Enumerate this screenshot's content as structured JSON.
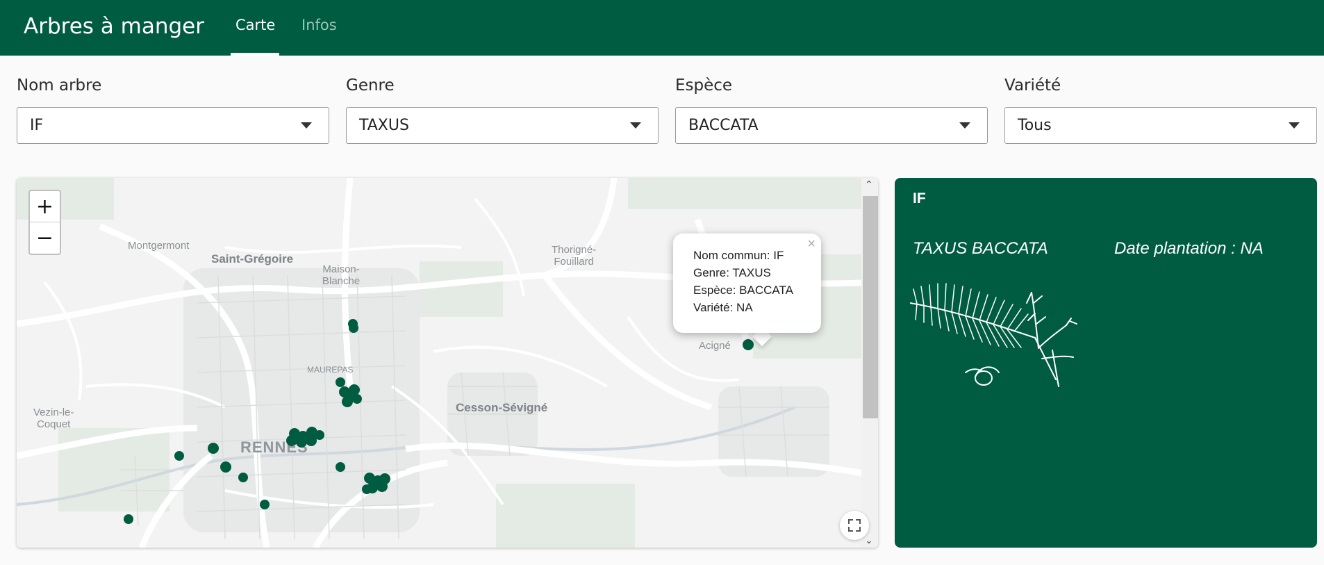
{
  "header": {
    "app_title": "Arbres à manger",
    "tabs": [
      {
        "label": "Carte",
        "active": true
      },
      {
        "label": "Infos",
        "active": false
      }
    ]
  },
  "filters": [
    {
      "label": "Nom arbre",
      "value": "IF"
    },
    {
      "label": "Genre",
      "value": "TAXUS"
    },
    {
      "label": "Espèce",
      "value": "BACCATA"
    },
    {
      "label": "Variété",
      "value": "Tous"
    }
  ],
  "map": {
    "zoom_in": "+",
    "zoom_out": "−",
    "places": {
      "montgermont": "Montgermont",
      "saint_gregoire": "Saint-Grégoire",
      "maison_blanche": "Maison-\nBlanche",
      "thorigne": "Thorigné-\nFouillard",
      "acigne": "Acigné",
      "maurepas": "MAUREPAS",
      "vezin": "Vezin-le-\nCoquet",
      "cesson": "Cesson-Sévigné",
      "rennes": "RENNES"
    },
    "popup": {
      "close": "×",
      "lines": [
        "Nom commun: IF",
        "Genre: TAXUS",
        "Espèce: BACCATA",
        "Variété: NA"
      ]
    },
    "marker_color": "#005c40"
  },
  "card": {
    "title": "IF",
    "species": "TAXUS BACCATA",
    "date": "Date plantation : NA",
    "background": "#005c40"
  }
}
